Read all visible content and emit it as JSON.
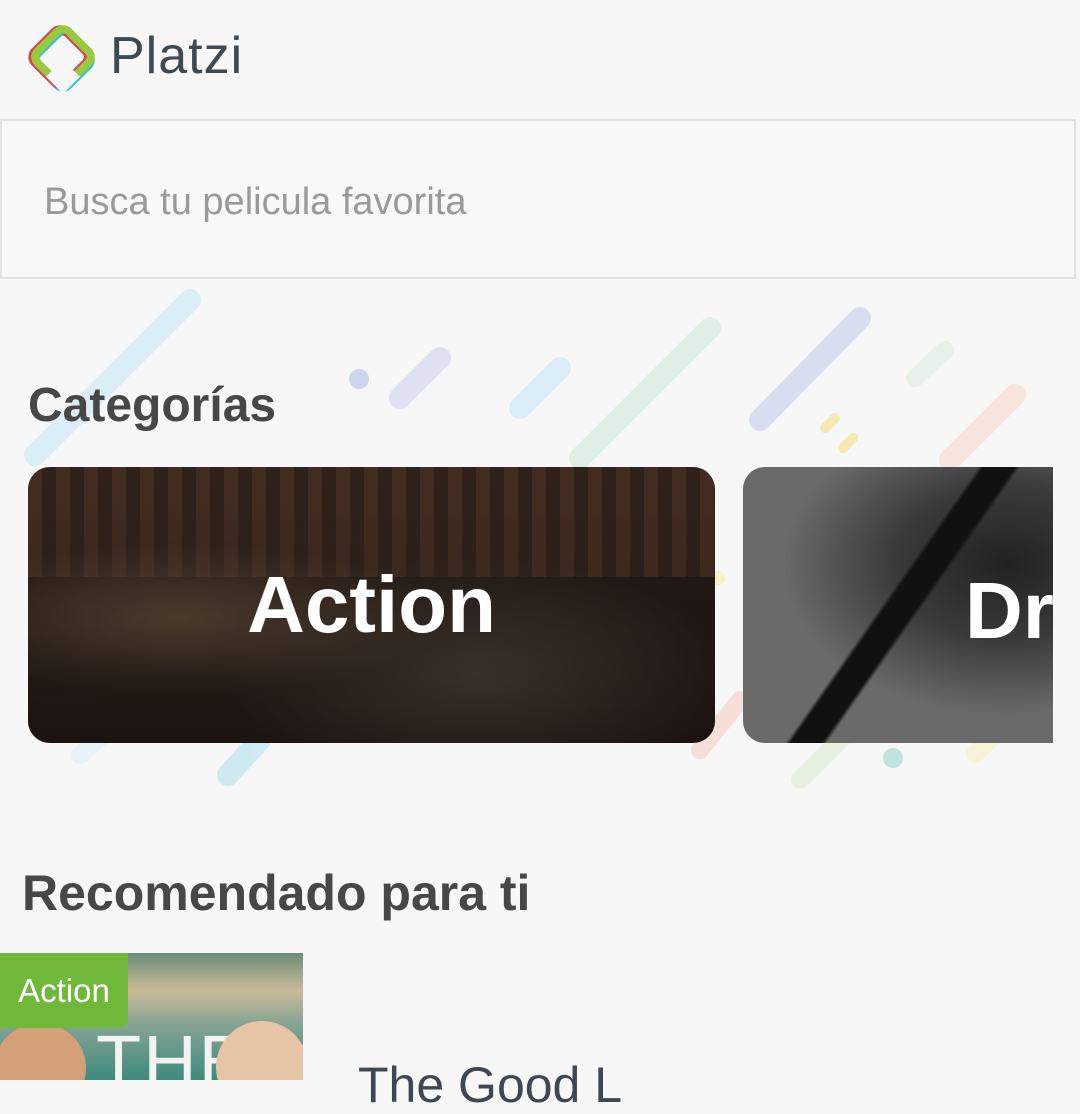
{
  "header": {
    "brand": "Platzi",
    "logo_icon": "platzi-logo-icon",
    "colors": {
      "green": "#98ca3f",
      "red": "#e23f4b",
      "cyan": "#2ec4d6"
    }
  },
  "search": {
    "placeholder": "Busca tu pelicula favorita",
    "value": ""
  },
  "categories": {
    "title": "Categorías",
    "items": [
      {
        "label": "Action"
      },
      {
        "label": "Drama"
      }
    ]
  },
  "recommended": {
    "title": "Recomendado para ti",
    "items": [
      {
        "badge": "Action",
        "title": "The Good L",
        "poster_text": "THE"
      }
    ]
  },
  "theme": {
    "background": "#f7f7f7",
    "badge_color": "#6fb83a",
    "title_color": "#474747"
  }
}
